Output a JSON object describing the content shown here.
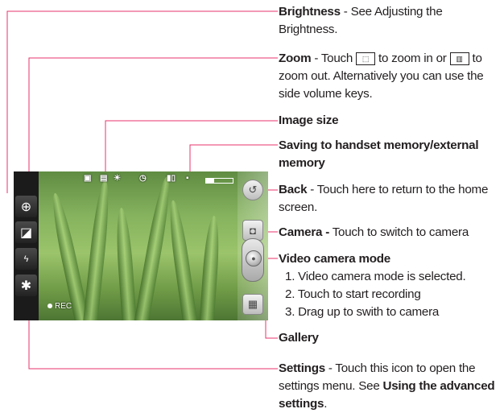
{
  "callouts": {
    "brightness": {
      "label": "Brightness",
      "text": " - See Adjusting the Brightness."
    },
    "zoom": {
      "label": "Zoom",
      "text_a": " - Touch ",
      "text_b": " to zoom in or ",
      "text_c": " to zoom out. Alternatively you can use the side volume keys.",
      "zoom_in_icon": "zoom-in-box-icon",
      "zoom_out_icon": "zoom-out-box-icon"
    },
    "image_size": {
      "label": "Image size"
    },
    "saving": {
      "label": "Saving to handset memory/external memory"
    },
    "back": {
      "label": "Back",
      "text": " - Touch here to return to the home screen."
    },
    "camera": {
      "label": "Camera -",
      "text": " Touch to switch to camera"
    },
    "video_mode": {
      "label": "Video camera mode",
      "steps": [
        "1. Video camera mode is selected.",
        "2. Touch to start recording",
        "3. Drag up to swith to camera"
      ]
    },
    "gallery": {
      "label": "Gallery"
    },
    "settings": {
      "label": "Settings",
      "text_a": " - Touch this icon to open the settings menu. See ",
      "link": "Using the advanced settings",
      "text_b": "."
    }
  },
  "screen": {
    "rec_label": "REC",
    "icons": [
      "zoom-icon",
      "brightness-icon",
      "flash-off-icon",
      "settings-gear-icon",
      "video-mode-icon",
      "image-size-icon",
      "white-balance-icon",
      "timer-icon",
      "battery-icon",
      "memory-icon",
      "back-icon",
      "camera-icon",
      "record-icon",
      "gallery-icon"
    ],
    "memory_used": 0.3
  },
  "colors": {
    "callout_line": "#e8336d",
    "text": "#231f20"
  }
}
